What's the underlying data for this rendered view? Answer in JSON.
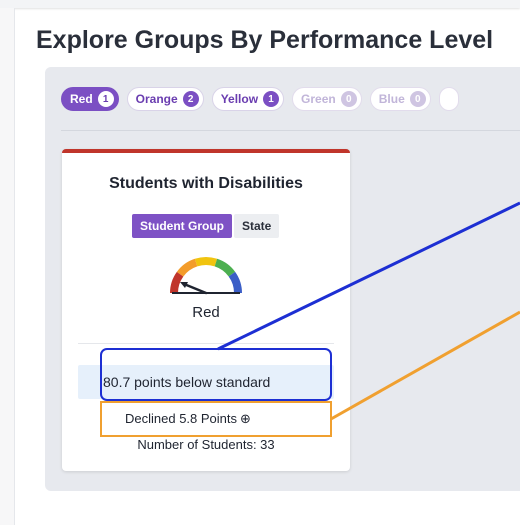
{
  "page": {
    "title": "Explore Groups By Performance Level"
  },
  "filters": [
    {
      "label": "Red",
      "count": "1",
      "state": "active"
    },
    {
      "label": "Orange",
      "count": "2",
      "state": "enabled"
    },
    {
      "label": "Yellow",
      "count": "1",
      "state": "enabled"
    },
    {
      "label": "Green",
      "count": "0",
      "state": "disabled"
    },
    {
      "label": "Blue",
      "count": "0",
      "state": "disabled"
    }
  ],
  "card": {
    "title": "Students with Disabilities",
    "accent_color": "#c0352b",
    "toggle": {
      "student_group": "Student Group",
      "state": "State"
    },
    "gauge": {
      "level": "Red",
      "segment_colors": [
        "#c0352b",
        "#f39c2b",
        "#f1c40f",
        "#4caf50",
        "#3b5ec7"
      ],
      "icon": "performance-gauge-icon"
    },
    "level_label": "Red",
    "points": "80.7 points below standard",
    "change": "Declined 5.8 Points",
    "change_icon": "down-arrow-circle-icon",
    "students": "Number of Students: 33"
  },
  "annotations": {
    "blue_color": "#1d2fd3",
    "orange_color": "#f0a030"
  }
}
